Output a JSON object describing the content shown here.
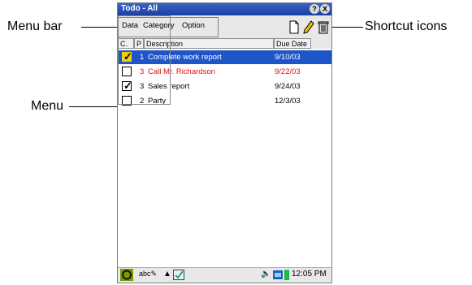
{
  "callouts": {
    "menu_bar": "Menu bar",
    "menu": "Menu",
    "shortcut_icons": "Shortcut icons"
  },
  "window": {
    "title": "Todo - All",
    "help_button": "?",
    "close_button": "X"
  },
  "menubar": {
    "items": [
      "Data",
      "Category",
      "Option"
    ]
  },
  "toolbar": {
    "icons": [
      "new-document-icon",
      "edit-pencil-icon",
      "trash-icon"
    ]
  },
  "table": {
    "columns": [
      "C.",
      "P",
      "Description",
      "Due Date"
    ],
    "rows": [
      {
        "checked": true,
        "priority": "1",
        "description": "Complete work report",
        "due": "9/10/03",
        "selected": true
      },
      {
        "checked": false,
        "priority": "3",
        "description": "Call Mr. Richardson",
        "due": "9/22/03",
        "color": "#e01010"
      },
      {
        "checked": true,
        "priority": "3",
        "description": "Sales report",
        "due": "9/24/03"
      },
      {
        "checked": false,
        "priority": "2",
        "description": "Party",
        "due": "12/3/03"
      }
    ]
  },
  "statusbar": {
    "time": "12:05 PM",
    "icons": [
      "start-icon",
      "handwriting-icon",
      "up-arrow-icon",
      "checkbox-icon",
      "speaker-icon",
      "keyboard-icon",
      "battery-icon"
    ]
  },
  "colors": {
    "selection": "#1e56c9",
    "overdue_text": "#e01010",
    "titlebar": "#1b3fa0"
  }
}
